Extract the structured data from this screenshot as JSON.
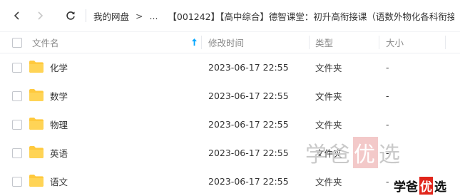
{
  "breadcrumb": {
    "items": [
      "我的网盘",
      "...",
      "【001242】【高中综合】德智课堂：初升高衔接课（语数外物化各科衔接..."
    ],
    "separator": ">",
    "trailing_arrow": ">"
  },
  "table": {
    "columns": {
      "name": "文件名",
      "modified": "修改时间",
      "type": "类型",
      "size": "大小"
    },
    "rows": [
      {
        "name": "化学",
        "modified": "2023-06-17 22:55",
        "type": "文件夹",
        "size": "-"
      },
      {
        "name": "数学",
        "modified": "2023-06-17 22:55",
        "type": "文件夹",
        "size": "-"
      },
      {
        "name": "物理",
        "modified": "2023-06-17 22:55",
        "type": "文件夹",
        "size": "-"
      },
      {
        "name": "英语",
        "modified": "2023-06-17 22:55",
        "type": "文件夹",
        "size": "-"
      },
      {
        "name": "语文",
        "modified": "2023-06-17 22:55",
        "type": "文件夹",
        "size": "-"
      }
    ]
  },
  "watermark": {
    "chars": [
      "学",
      "爸",
      "优",
      "选"
    ]
  },
  "colors": {
    "folder": "#ffc93d",
    "sort_arrow": "#06a7ff",
    "watermark_red": "#e1251b"
  },
  "icons": {
    "back": "chevron-left-icon",
    "forward": "chevron-right-icon",
    "refresh": "refresh-icon",
    "sort": "sort-ascending-icon",
    "folder": "folder-icon"
  }
}
